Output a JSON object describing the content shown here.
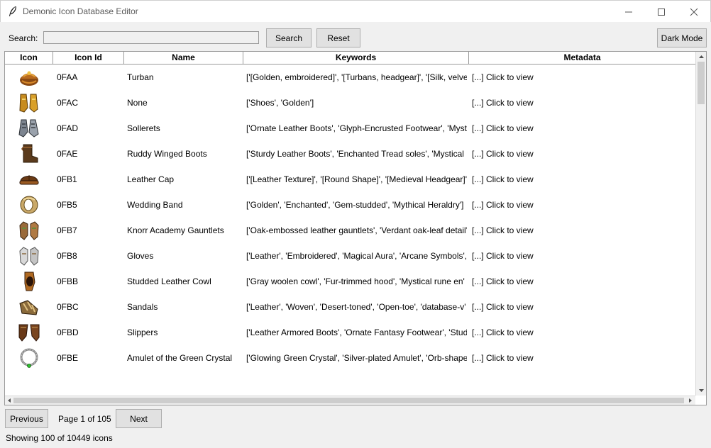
{
  "window": {
    "title": "Demonic Icon Database Editor",
    "controls": [
      "minimize-icon",
      "maximize-icon",
      "close-icon"
    ]
  },
  "toolbar": {
    "search_label": "Search:",
    "search_value": "",
    "search_button": "Search",
    "reset_button": "Reset",
    "dark_mode_button": "Dark Mode"
  },
  "table": {
    "columns": [
      "Icon",
      "Icon Id",
      "Name",
      "Keywords",
      "Metadata"
    ],
    "rows": [
      {
        "icon": "turban-icon",
        "id": "0FAA",
        "name": "Turban",
        "keywords": "['[Golden, embroidered]', '[Turbans, headgear]', '[Silk, velvet]'",
        "metadata": "[...] Click to view"
      },
      {
        "icon": "golden-shoes-icon",
        "id": "0FAC",
        "name": "None",
        "keywords": "['Shoes', 'Golden']",
        "metadata": "[...] Click to view"
      },
      {
        "icon": "sollerets-icon",
        "id": "0FAD",
        "name": "Sollerets",
        "keywords": "['Ornate Leather Boots', 'Glyph-Encrusted Footwear', 'Mystical'",
        "metadata": "[...] Click to view"
      },
      {
        "icon": "boots-icon",
        "id": "0FAE",
        "name": "Ruddy Winged Boots",
        "keywords": "['Sturdy Leather Boots', 'Enchanted Tread soles', 'Mystical M'",
        "metadata": "[...] Click to view"
      },
      {
        "icon": "leather-cap-icon",
        "id": "0FB1",
        "name": "Leather Cap",
        "keywords": "['[Leather Texture]', '[Round Shape]', '[Medieval Headgear]'",
        "metadata": "[...] Click to view"
      },
      {
        "icon": "ring-icon",
        "id": "0FB5",
        "name": "Wedding Band",
        "keywords": "['Golden', 'Enchanted', 'Gem-studded', 'Mythical Heraldry']",
        "metadata": "[...] Click to view"
      },
      {
        "icon": "gauntlets-icon",
        "id": "0FB7",
        "name": "Knorr Academy Gauntlets",
        "keywords": "['Oak-embossed leather gauntlets', 'Verdant oak-leaf detail'",
        "metadata": "[...] Click to view"
      },
      {
        "icon": "gloves-icon",
        "id": "0FB8",
        "name": "Gloves",
        "keywords": "['Leather', 'Embroidered', 'Magical Aura', 'Arcane Symbols',",
        "metadata": "[...] Click to view"
      },
      {
        "icon": "cowl-icon",
        "id": "0FBB",
        "name": "Studded Leather Cowl",
        "keywords": "['Gray woolen cowl', 'Fur-trimmed hood', 'Mystical rune en'",
        "metadata": "[...] Click to view"
      },
      {
        "icon": "sandals-icon",
        "id": "0FBC",
        "name": "Sandals",
        "keywords": "['Leather', 'Woven', 'Desert-toned', 'Open-toe', 'database-v'",
        "metadata": "[...] Click to view"
      },
      {
        "icon": "slippers-icon",
        "id": "0FBD",
        "name": "Slippers",
        "keywords": "['Leather Armored Boots', 'Ornate Fantasy Footwear', 'Stude'",
        "metadata": "[...] Click to view"
      },
      {
        "icon": "amulet-icon",
        "id": "0FBE",
        "name": "Amulet of the Green Crystal",
        "keywords": "['Glowing Green Crystal', 'Silver-plated Amulet', 'Orb-shaped'",
        "metadata": "[...] Click to view"
      }
    ]
  },
  "pagination": {
    "previous_button": "Previous",
    "page_label": "Page 1 of 105",
    "next_button": "Next"
  },
  "status_text": "Showing 100 of 10449 icons",
  "colors": {
    "titlebar": "#ffffff",
    "window_bg": "#f0f0f0",
    "table_bg": "#ffffff",
    "button_bg": "#e1e1e1"
  }
}
